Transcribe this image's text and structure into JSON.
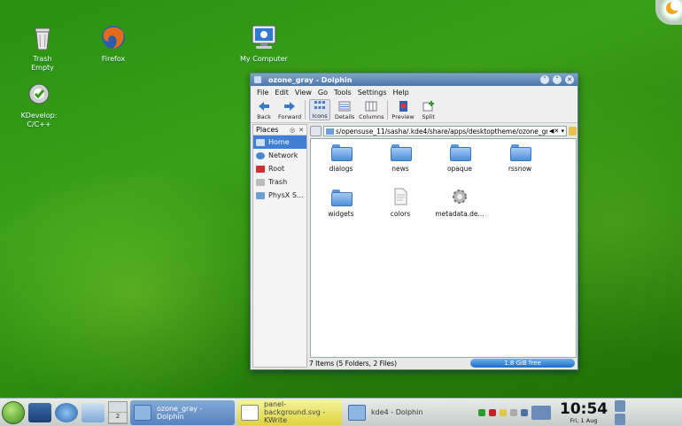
{
  "desktop": {
    "icons": [
      {
        "label": "Trash",
        "sub": "Empty"
      },
      {
        "label": "Firefox"
      },
      {
        "label": "My Computer"
      },
      {
        "label": "KDevelop:",
        "sub": "C/C++"
      }
    ]
  },
  "window": {
    "title": "ozone_gray - Dolphin",
    "controls": [
      "˅",
      "˄",
      "✕"
    ],
    "menu": [
      "File",
      "Edit",
      "View",
      "Go",
      "Tools",
      "Settings",
      "Help"
    ],
    "toolbar": {
      "back": "Back",
      "forward": "Forward",
      "icons": "Icons",
      "details": "Details",
      "columns": "Columns",
      "preview": "Preview",
      "split": "Split"
    },
    "places": {
      "header": "Places",
      "items": [
        "Home",
        "Network",
        "Root",
        "Trash",
        "PhysX S..."
      ],
      "selected": "Home"
    },
    "location": "s/opensuse_11/sasha/.kde4/share/apps/desktoptheme/ozone_gray",
    "files": [
      {
        "name": "dialogs",
        "kind": "folder"
      },
      {
        "name": "news",
        "kind": "folder"
      },
      {
        "name": "opaque",
        "kind": "folder"
      },
      {
        "name": "rssnow",
        "kind": "folder"
      },
      {
        "name": "widgets",
        "kind": "folder"
      },
      {
        "name": "colors",
        "kind": "file"
      },
      {
        "name": "metadata.de...",
        "kind": "config"
      }
    ],
    "status": "7 Items (5 Folders, 2 Files)",
    "free_space": "1.8 GiB free"
  },
  "taskbar": {
    "pager_second": "2",
    "tasks": [
      {
        "label": "ozone_gray - Dolphin"
      },
      {
        "line1": "panel-background.svg -",
        "line2": "KWrite"
      },
      {
        "label": "kde4 - Dolphin"
      }
    ],
    "clock_time": "10:54",
    "clock_date": "Fri, 1 Aug"
  },
  "colors": {
    "accent": "#3f7fd4",
    "titlebar": "#4d77ab",
    "desktop": "#2c8a0e"
  }
}
